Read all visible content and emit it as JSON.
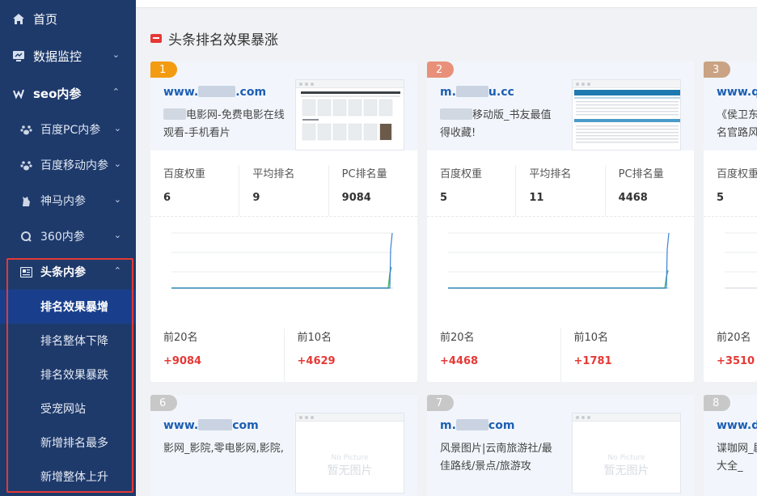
{
  "sidebar": {
    "home": "首页",
    "data_monitor": "数据监控",
    "seo_group": "seo内参",
    "baidu_pc": "百度PC内参",
    "baidu_mobile": "百度移动内参",
    "shenma": "神马内参",
    "s360": "360内参",
    "toutiao": "头条内参",
    "leaf_1": "排名效果暴增",
    "leaf_2": "排名整体下降",
    "leaf_3": "排名效果暴跌",
    "leaf_4": "受宠网站",
    "leaf_5": "新增排名最多",
    "leaf_6": "新增整体上升"
  },
  "section_title": "头条排名效果暴涨",
  "labels": {
    "weight": "百度权重",
    "avg_rank": "平均排名",
    "pc_count": "PC排名量",
    "top20": "前20名",
    "top10": "前10名",
    "no_picture": "No Picture",
    "no_picture_cn": "暂无图片"
  },
  "cards": [
    {
      "rank": "1",
      "domain": "www.",
      "domain_tail": ".com",
      "desc": "电影网-免费电影在线观看-手机看片",
      "weight": "6",
      "avg": "9",
      "pc": "9084",
      "top20": "+9084",
      "top10": "+4629"
    },
    {
      "rank": "2",
      "domain": "m.",
      "domain_tail": "u.cc",
      "desc": "移动版_书友最值得收藏!",
      "weight": "5",
      "avg": "11",
      "pc": "4468",
      "top20": "+4468",
      "top10": "+1781"
    },
    {
      "rank": "3",
      "domain": "www.qw",
      "domain_tail": "",
      "desc": "《侯卫东名官路风",
      "weight": "5",
      "avg": "",
      "pc": "",
      "top20": "+3510",
      "top10": ""
    },
    {
      "rank": "6",
      "domain": "www.",
      "domain_tail": "com",
      "desc": "影网_影院,零电影网,影院,",
      "weight": "",
      "avg": "",
      "pc": "",
      "top20": "",
      "top10": ""
    },
    {
      "rank": "7",
      "domain": "m.",
      "domain_tail": "com",
      "desc": "风景图片|云南旅游社/最佳路线/景点/旅游攻",
      "weight": "",
      "avg": "",
      "pc": "",
      "top20": "",
      "top10": ""
    },
    {
      "rank": "8",
      "domain": "www.di",
      "domain_tail": "",
      "desc": "谍咖网_剧大全_",
      "weight": "",
      "avg": "",
      "pc": "",
      "top20": "",
      "top10": ""
    }
  ],
  "colors": {
    "sidebar_bg": "#1e3a6b",
    "active_item": "#193f8c",
    "highlight_border": "#e53935",
    "rank_1": "#f39c12",
    "rank_2": "#e8907a",
    "rank_3": "#c9a383",
    "rank_other": "#c8c8c8",
    "link": "#1d5fb3",
    "positive": "#e53935"
  }
}
